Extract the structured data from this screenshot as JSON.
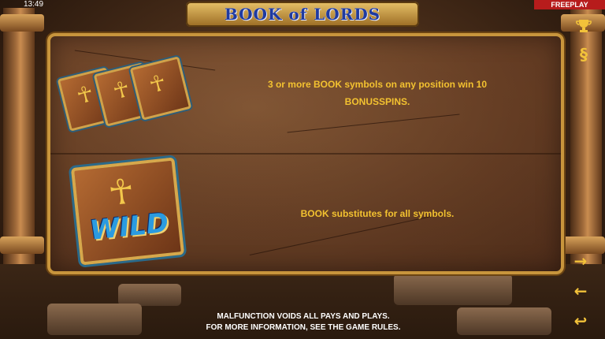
{
  "status_bar": {
    "time": "13:49",
    "mode": "FREEPLAY"
  },
  "header": {
    "logo": "BOOK of LORDS"
  },
  "paytable": {
    "rows": [
      {
        "text_line1": "3 or more BOOK symbols on any position win 10",
        "text_line2": "BONUSSPINS."
      },
      {
        "text_line1": "BOOK substitutes for all symbols.",
        "symbol_label": "WILD"
      }
    ]
  },
  "sidebar": {
    "trophy_icon": "trophy-icon",
    "paragraph_icon": "§",
    "next_icon": "→",
    "prev_icon": "←",
    "back_icon": "↩"
  },
  "footer": {
    "line1": "MALFUNCTION VOIDS ALL PAYS AND PLAYS.",
    "line2": "FOR MORE INFORMATION, SEE THE GAME RULES."
  },
  "colors": {
    "accent_text": "#f3c230",
    "mode_badge": "#b71c1c",
    "logo_blue": "#1f3aa0"
  }
}
